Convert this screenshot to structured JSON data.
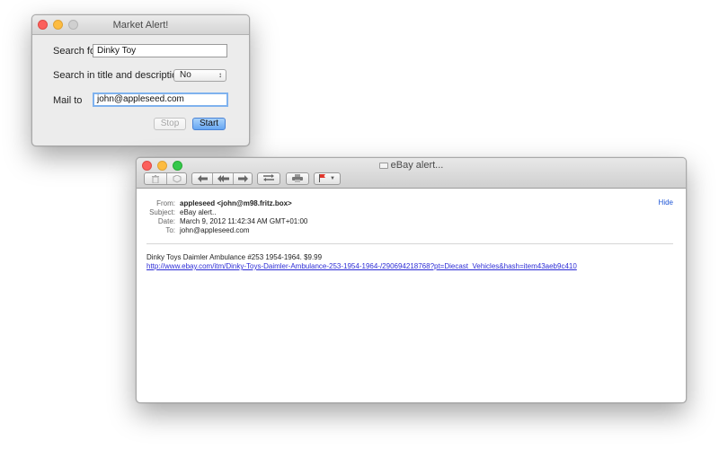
{
  "market_window": {
    "title": "Market Alert!",
    "search_label": "Search for",
    "search_value": "Dinky Toy",
    "scope_label": "Search in title and description",
    "scope_value": "No",
    "mail_label": "Mail to",
    "mail_value": "john@appleseed.com",
    "stop_label": "Stop",
    "start_label": "Start"
  },
  "mail_window": {
    "title": "eBay alert...",
    "toolbar": {
      "buttons": [
        "trash-icon",
        "junk-icon",
        "reply-icon",
        "reply-all-icon",
        "forward-icon",
        "redirect-icon",
        "print-icon",
        "flag-icon"
      ]
    },
    "headers": [
      {
        "key": "From:",
        "value": "appleseed <john@m98.fritz.box>"
      },
      {
        "key": "Subject:",
        "value": "eBay alert.."
      },
      {
        "key": "Date:",
        "value": "March 9, 2012 11:42:34 AM GMT+01:00"
      },
      {
        "key": "To:",
        "value": "john@appleseed.com"
      }
    ],
    "hide_label": "Hide",
    "body_text": "Dinky Toys Daimler Ambulance #253 1954-1964. $9.99",
    "body_link": "http://www.ebay.com/itm/Dinky-Toys-Daimler-Ambulance-253-1954-1964-/290694218768?pt=Diecast_Vehicles&hash=item43aeb9c410"
  },
  "colors": {
    "focus_ring": "#7fb2ee",
    "primary_button": "#66a6f2",
    "link": "#2c2cd6"
  }
}
